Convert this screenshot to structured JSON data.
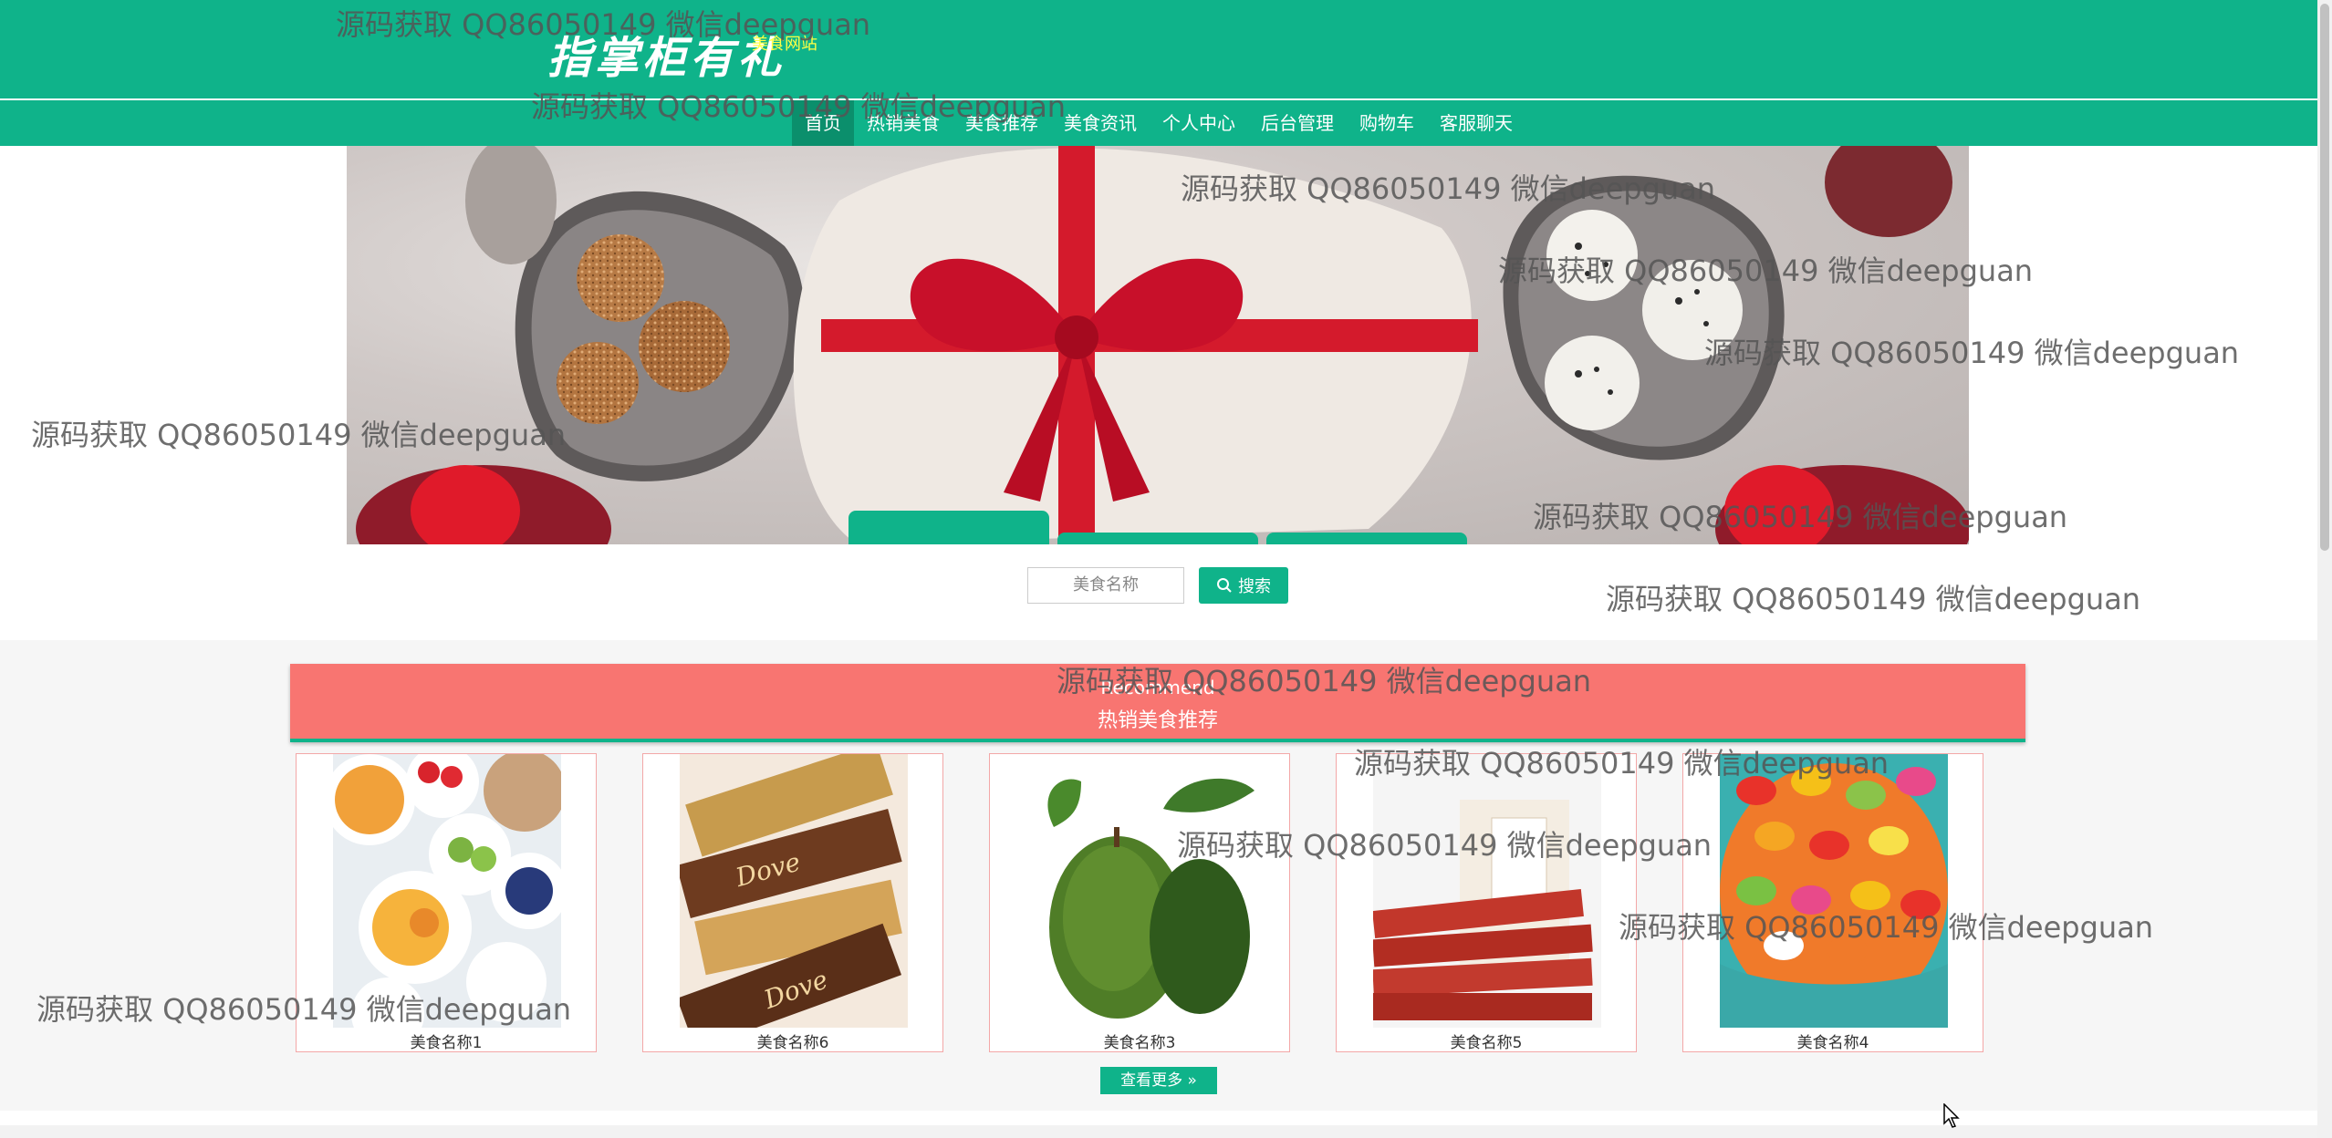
{
  "header": {
    "logo_title": "指掌柜有礼",
    "logo_subtitle": "美食网站"
  },
  "nav": {
    "items": [
      "首页",
      "热销美食",
      "美食推荐",
      "美食资讯",
      "个人中心",
      "后台管理",
      "购物车",
      "客服聊天"
    ],
    "active_index": 0
  },
  "search": {
    "placeholder": "美食名称",
    "button_label": "搜索"
  },
  "recommend": {
    "title_en": "Recommend",
    "title_cn": "热销美食推荐",
    "items": [
      {
        "name": "美食名称1"
      },
      {
        "name": "美食名称6"
      },
      {
        "name": "美食名称3"
      },
      {
        "name": "美食名称5"
      },
      {
        "name": "美食名称4"
      }
    ],
    "more_label": "查看更多"
  },
  "watermark": "源码获取 QQ86050149 微信deepguan",
  "colors": {
    "brand": "#0fb38a",
    "recommend_header": "#f87571",
    "logo_subtitle": "#ffff44"
  }
}
